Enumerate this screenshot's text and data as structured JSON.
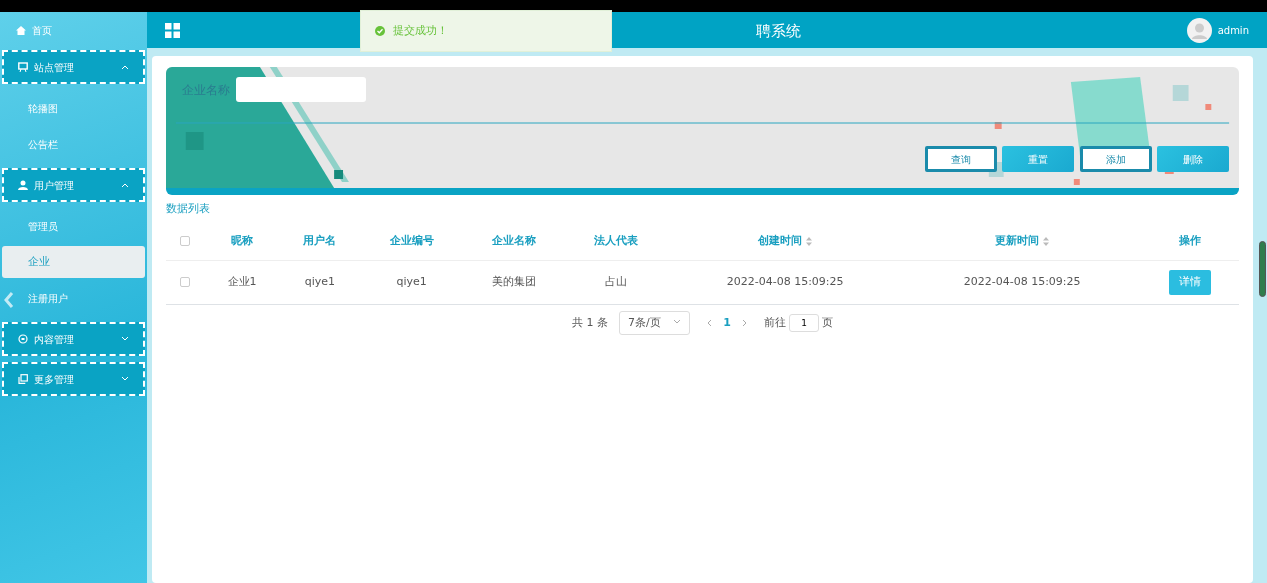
{
  "header": {
    "title": "聘系统",
    "user": "admin"
  },
  "toast": {
    "message": "提交成功！"
  },
  "sidebar": {
    "items": [
      {
        "label": "首页"
      },
      {
        "label": "站点管理",
        "expanded": true,
        "children": [
          {
            "label": "轮播图",
            "selected": false
          },
          {
            "label": "公告栏",
            "selected": false
          }
        ]
      },
      {
        "label": "用户管理",
        "expanded": true,
        "children": [
          {
            "label": "管理员",
            "selected": false
          },
          {
            "label": "企业",
            "selected": true
          },
          {
            "label": "注册用户",
            "selected": false
          }
        ]
      },
      {
        "label": "内容管理",
        "expanded": false
      },
      {
        "label": "更多管理",
        "expanded": false
      }
    ]
  },
  "search": {
    "label": "企业名称",
    "buttons": [
      {
        "label": "查询",
        "kind": "outline"
      },
      {
        "label": "重置",
        "kind": "fill"
      },
      {
        "label": "添加",
        "kind": "outline"
      },
      {
        "label": "删除",
        "kind": "fill"
      }
    ]
  },
  "list_title": "数据列表",
  "table": {
    "select_all_checked": false,
    "columns": [
      {
        "label": "昵称",
        "sortable": false
      },
      {
        "label": "用户名",
        "sortable": false
      },
      {
        "label": "企业编号",
        "sortable": false
      },
      {
        "label": "企业名称",
        "sortable": false
      },
      {
        "label": "法人代表",
        "sortable": false
      },
      {
        "label": "创建时间",
        "sortable": true
      },
      {
        "label": "更新时间",
        "sortable": true
      },
      {
        "label": "操作",
        "sortable": false
      }
    ],
    "rows": [
      {
        "checked": false,
        "cells": [
          "企业1",
          "qiye1",
          "qiye1",
          "美的集团",
          "占山",
          "2022-04-08 15:09:25",
          "2022-04-08 15:09:25"
        ],
        "action": "详情"
      }
    ]
  },
  "pagination": {
    "total": "共 1 条",
    "page_size": "7条/页",
    "pages": [
      {
        "label": "1",
        "selected": true
      }
    ],
    "goto_label": "前往",
    "goto_value": "1",
    "goto_suffix": "页"
  }
}
